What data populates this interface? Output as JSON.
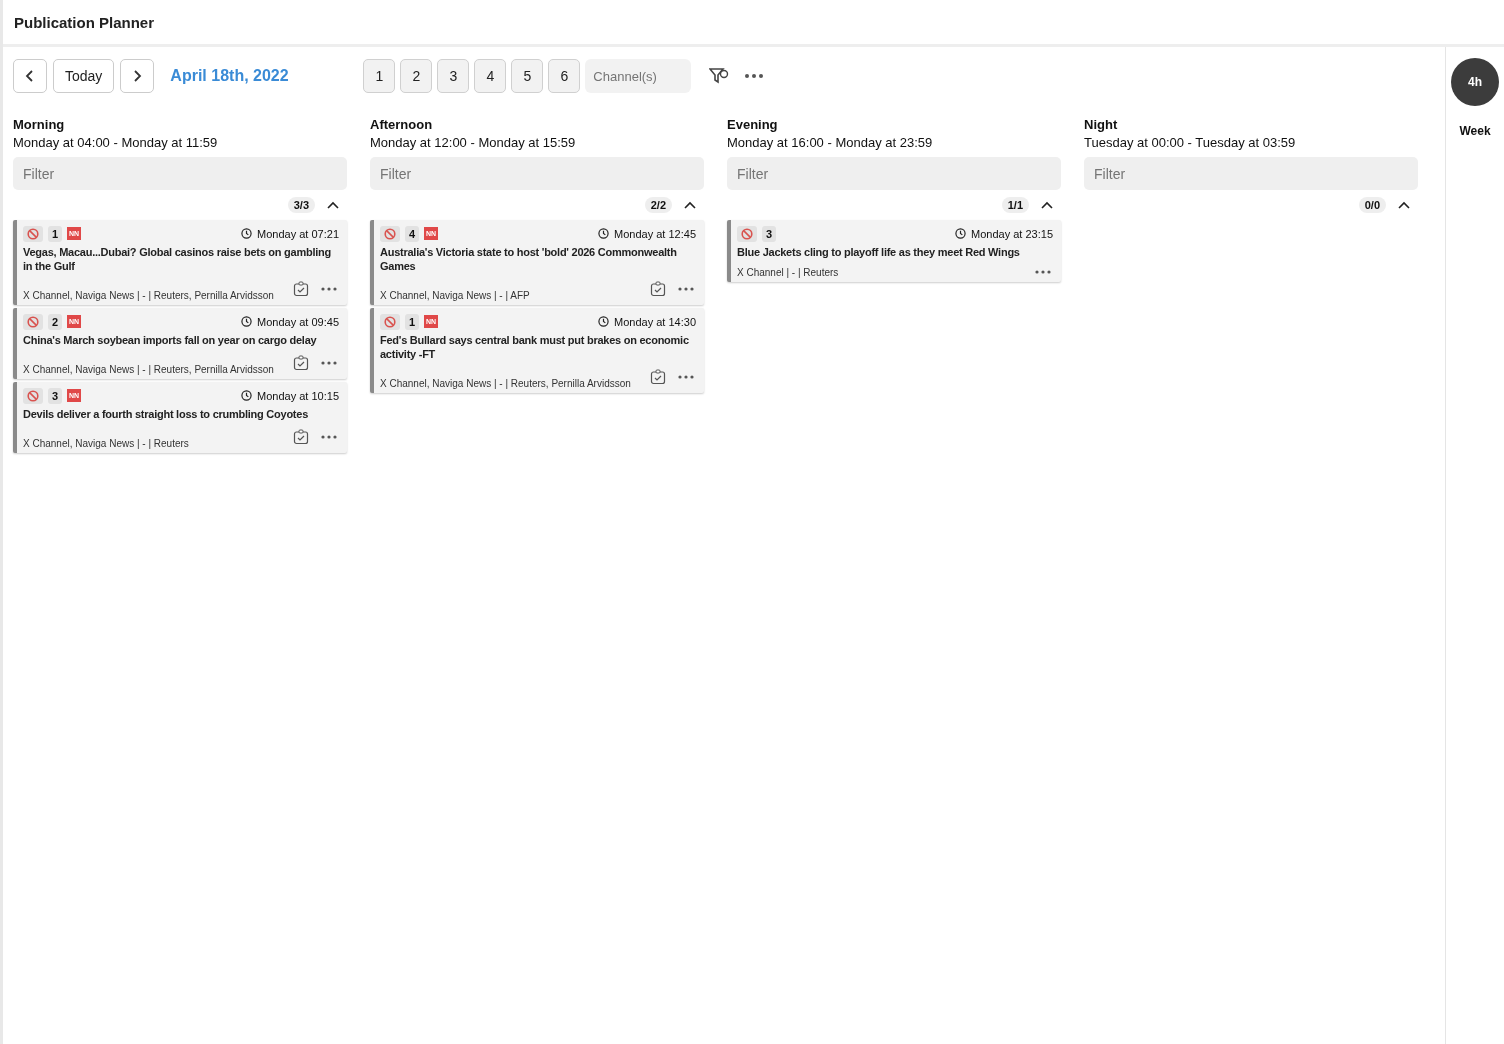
{
  "window": {
    "title": "Publication Planner"
  },
  "toolbar": {
    "today": "Today",
    "date": "April 18th, 2022",
    "pages": [
      "1",
      "2",
      "3",
      "4",
      "5",
      "6"
    ],
    "channel_field": {
      "placeholder": "Channel(s)"
    }
  },
  "columns": [
    {
      "title": "Morning",
      "range": "Monday at 04:00 - Monday at 11:59",
      "filter": {
        "placeholder": "Filter"
      },
      "count": "3/3",
      "expanded": true,
      "cards": [
        {
          "number": "1",
          "badge": "NN",
          "time": "Monday at 07:21",
          "headline": "Vegas, Macau...Dubai? Global casinos raise bets on gambling in the Gulf",
          "meta": "X Channel, Naviga News | - | Reuters, Pernilla Arvidsson",
          "checklist": true
        },
        {
          "number": "2",
          "badge": "NN",
          "time": "Monday at 09:45",
          "headline": "China's March soybean imports fall on year on cargo delay",
          "meta": "X Channel, Naviga News | - | Reuters, Pernilla Arvidsson",
          "checklist": true
        },
        {
          "number": "3",
          "badge": "NN",
          "time": "Monday at 10:15",
          "headline": "Devils deliver a fourth straight loss to crumbling Coyotes",
          "meta": "X Channel, Naviga News | - | Reuters",
          "checklist": true
        }
      ]
    },
    {
      "title": "Afternoon",
      "range": "Monday at 12:00 - Monday at 15:59",
      "filter": {
        "placeholder": "Filter"
      },
      "count": "2/2",
      "expanded": true,
      "cards": [
        {
          "number": "4",
          "badge": "NN",
          "time": "Monday at 12:45",
          "headline": "Australia's Victoria state to host 'bold' 2026 Commonwealth Games",
          "meta": "X Channel, Naviga News | - | AFP",
          "checklist": true
        },
        {
          "number": "1",
          "badge": "NN",
          "time": "Monday at 14:30",
          "headline": "Fed's Bullard says central bank must put brakes on economic activity -FT",
          "meta": "X Channel, Naviga News | - | Reuters, Pernilla Arvidsson",
          "checklist": true
        }
      ]
    },
    {
      "title": "Evening",
      "range": "Monday at 16:00 - Monday at 23:59",
      "filter": {
        "placeholder": "Filter"
      },
      "count": "1/1",
      "expanded": true,
      "cards": [
        {
          "number": "3",
          "time": "Monday at 23:15",
          "headline": "Blue Jackets cling to playoff life as they meet Red Wings",
          "meta": "X Channel | - | Reuters",
          "checklist": false
        }
      ]
    },
    {
      "title": "Night",
      "range": "Tuesday at 00:00 - Tuesday at 03:59",
      "filter": {
        "placeholder": "Filter"
      },
      "count": "0/0",
      "expanded": true
    }
  ],
  "views": [
    {
      "label": "4h",
      "selected": true
    },
    {
      "label": "Week",
      "selected": false
    }
  ]
}
